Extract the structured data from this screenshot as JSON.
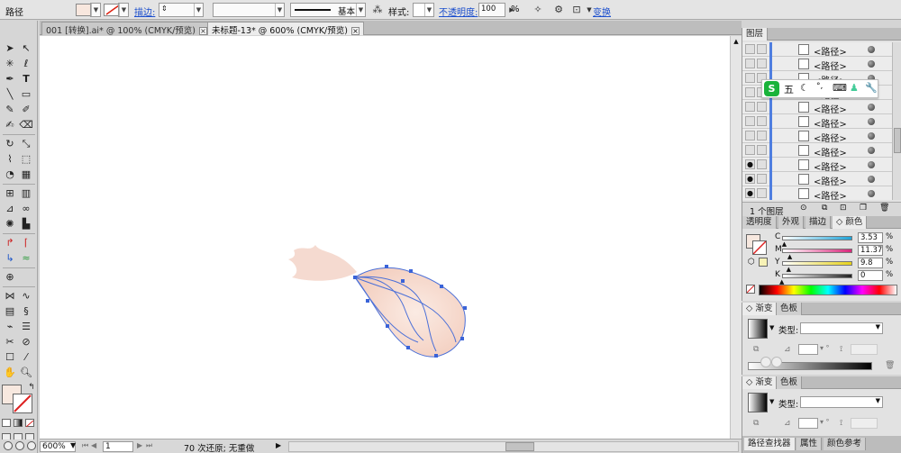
{
  "control_bar": {
    "mode_label": "路径",
    "stroke_label": "描边:",
    "stroke_weight_value": "",
    "stroke_profile_label": "基本",
    "style_label": "样式:",
    "opacity_label": "不透明度:",
    "opacity_value": "100",
    "opacity_unit": "%",
    "transform_label": "变换",
    "fill_color": "#f8e7de"
  },
  "tabs": [
    {
      "label": "001 [转换].ai* @ 100% (CMYK/预览)",
      "active": false
    },
    {
      "label": "未标题-13* @ 600% (CMYK/预览)",
      "active": true
    }
  ],
  "tools": {
    "fill_color": "#f7e8df"
  },
  "layers_panel": {
    "tab_label": "图层",
    "rows": [
      {
        "label": "<路径>",
        "visible": false
      },
      {
        "label": "<路径>",
        "visible": false
      },
      {
        "label": "<路径>",
        "visible": false
      },
      {
        "label": "<路径>",
        "visible": false
      },
      {
        "label": "<路径>",
        "visible": false
      },
      {
        "label": "<路径>",
        "visible": false
      },
      {
        "label": "<路径>",
        "visible": false
      },
      {
        "label": "<路径>",
        "visible": false
      },
      {
        "label": "<路径>",
        "visible": true
      },
      {
        "label": "<路径>",
        "visible": true
      },
      {
        "label": "<路径>",
        "visible": true
      }
    ],
    "footer_label": "1 个图层"
  },
  "ime_toolbar": {
    "logo": "S",
    "mode": "五",
    "symbols": [
      "☾",
      "°,",
      "⌨",
      "♟",
      "🔧"
    ]
  },
  "color_panel": {
    "tabs": [
      "透明度",
      "外观",
      "描边",
      "颜色"
    ],
    "active_tab": "颜色",
    "channels": [
      {
        "label": "C",
        "value": "3.53",
        "unit": "%",
        "level": 3.53,
        "color": "#1fa3d8"
      },
      {
        "label": "M",
        "value": "11.37",
        "unit": "%",
        "level": 11.37,
        "color": "#d8267a"
      },
      {
        "label": "Y",
        "value": "9.8",
        "unit": "%",
        "level": 9.8,
        "color": "#e6d21a"
      },
      {
        "label": "K",
        "value": "0",
        "unit": "%",
        "level": 0,
        "color": "#222222"
      }
    ]
  },
  "gradient_panel_1": {
    "tabs": [
      "渐变",
      "色板"
    ],
    "type_label": "类型:"
  },
  "gradient_panel_2": {
    "tabs": [
      "渐变",
      "色板"
    ],
    "type_label": "类型:"
  },
  "bottom_tabs": [
    "路径查找器",
    "属性",
    "颜色参考"
  ],
  "status_bar": {
    "zoom": "600%",
    "artboard": "1",
    "undo_text": "70 次还原; 无重做"
  }
}
